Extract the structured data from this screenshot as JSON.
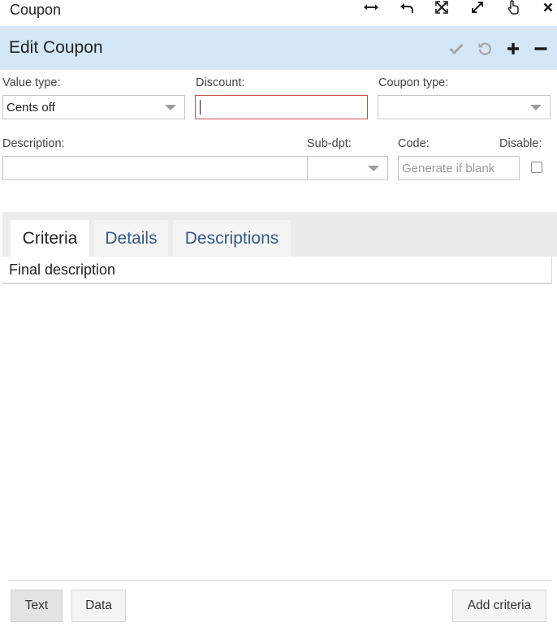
{
  "window": {
    "title": "Coupon",
    "controls": [
      "resize-horizontal-icon",
      "undo-icon",
      "shrink-icon",
      "expand-icon",
      "pointer-icon",
      "close-icon"
    ]
  },
  "header": {
    "title": "Edit Coupon",
    "actions": [
      "check-icon",
      "refresh-icon",
      "plus-icon",
      "minus-icon"
    ]
  },
  "form": {
    "value_type": {
      "label": "Value type:",
      "value": "Cents off"
    },
    "discount": {
      "label": "Discount:",
      "value": ""
    },
    "coupon_type": {
      "label": "Coupon type:",
      "value": ""
    },
    "description": {
      "label": "Description:",
      "value": ""
    },
    "sub_dpt": {
      "label": "Sub-dpt:",
      "value": ""
    },
    "code": {
      "label": "Code:",
      "placeholder": "Generate if blank"
    },
    "disable": {
      "label": "Disable:",
      "checked": false
    }
  },
  "tabs": [
    {
      "label": "Criteria",
      "active": true
    },
    {
      "label": "Details",
      "active": false
    },
    {
      "label": "Descriptions",
      "active": false
    }
  ],
  "grid": {
    "column": "Final description"
  },
  "footer": {
    "text_button": "Text",
    "data_button": "Data",
    "add_button": "Add criteria"
  },
  "colors": {
    "header_bg": "#d3e7f7",
    "tab_link": "#345a85",
    "error_border": "#c8504a"
  }
}
